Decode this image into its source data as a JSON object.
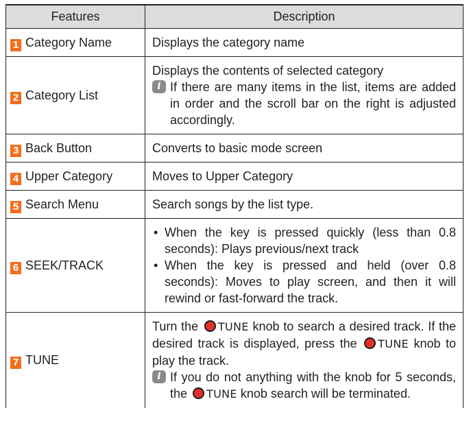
{
  "header": {
    "features": "Features",
    "description": "Description"
  },
  "rows": [
    {
      "num": "1",
      "feature": "Category Name",
      "description": "Displays the category name"
    },
    {
      "num": "2",
      "feature": "Category List",
      "description": "Displays the contents of selected category",
      "note": "If there are many items in the list, items are added in order and the scroll bar on the right is adjusted accordingly."
    },
    {
      "num": "3",
      "feature": "Back Button",
      "description": "Converts to basic mode screen"
    },
    {
      "num": "4",
      "feature": "Upper Category",
      "description": "Moves to Upper Category"
    },
    {
      "num": "5",
      "feature": "Search Menu",
      "description": "Search songs by the list type."
    },
    {
      "num": "6",
      "feature": "SEEK/TRACK",
      "bullets": [
        "When the key is pressed quickly (less than 0.8 seconds): Plays previous/next track",
        "When the key is pressed and held (over 0.8 seconds): Moves to play screen, and then it will rewind or fast-forward the track."
      ]
    },
    {
      "num": "7",
      "feature": "TUNE",
      "p1_a": "Turn the",
      "p1_b": "knob to search a desired track. If the desired track is displayed, press the",
      "p1_c": "knob to play the track.",
      "tune_label": "TUNE",
      "note_a": "If you do not anything with the knob for 5 seconds, the",
      "note_b": "knob search will be terminated."
    }
  ],
  "icons": {
    "note": "info-i-icon",
    "knob": "tune-knob-icon",
    "bullet": "•",
    "note_glyph": "i"
  },
  "colors": {
    "number_badge": "#f26f1e",
    "header_bg": "#dcdcdc",
    "knob": "#e0312b"
  }
}
